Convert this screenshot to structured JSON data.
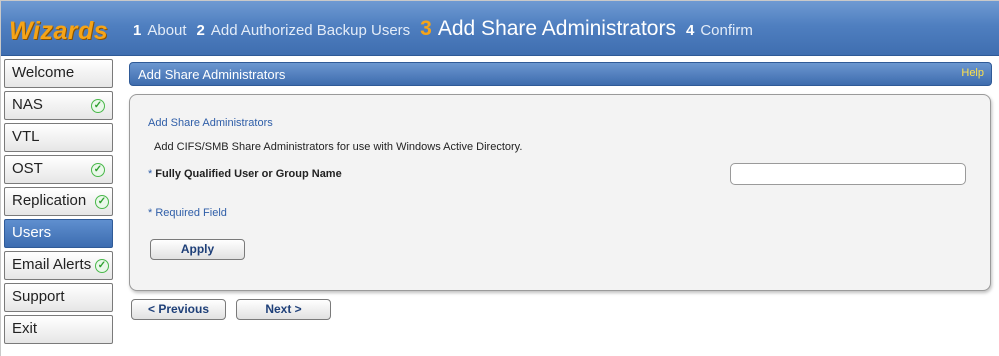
{
  "app": {
    "logo": "Wizards"
  },
  "wizard_steps": [
    {
      "num": "1",
      "label": "About",
      "active": false
    },
    {
      "num": "2",
      "label": "Add Authorized Backup Users",
      "active": false
    },
    {
      "num": "3",
      "label": "Add Share Administrators",
      "active": true
    },
    {
      "num": "4",
      "label": "Confirm",
      "active": false
    }
  ],
  "sidebar": {
    "items": [
      {
        "label": "Welcome",
        "checked": false,
        "active": false
      },
      {
        "label": "NAS",
        "checked": true,
        "active": false
      },
      {
        "label": "VTL",
        "checked": false,
        "active": false
      },
      {
        "label": "OST",
        "checked": true,
        "active": false
      },
      {
        "label": "Replication",
        "checked": true,
        "active": false
      },
      {
        "label": "Users",
        "checked": false,
        "active": true
      },
      {
        "label": "Email Alerts",
        "checked": true,
        "active": false
      },
      {
        "label": "Support",
        "checked": false,
        "active": false
      },
      {
        "label": "Exit",
        "checked": false,
        "active": false
      }
    ],
    "check_icon": "check-circle-icon"
  },
  "panel": {
    "title": "Add Share Administrators",
    "help_label": "Help"
  },
  "form": {
    "section_title": "Add Share Administrators",
    "description": "Add CIFS/SMB Share Administrators for use with Windows Active Directory.",
    "required_marker": "*",
    "field_label": "Fully Qualified User or Group Name",
    "field_value": "",
    "field_placeholder": "",
    "required_note": "* Required Field",
    "apply_label": "Apply"
  },
  "nav_buttons": {
    "previous_label": "< Previous",
    "next_label": "Next >"
  },
  "colors": {
    "accent_orange": "#f6a417",
    "header_blue": "#4f7fc0",
    "link_blue": "#2f5ea8",
    "help_yellow": "#ffe14a",
    "check_green": "#49b84a"
  }
}
